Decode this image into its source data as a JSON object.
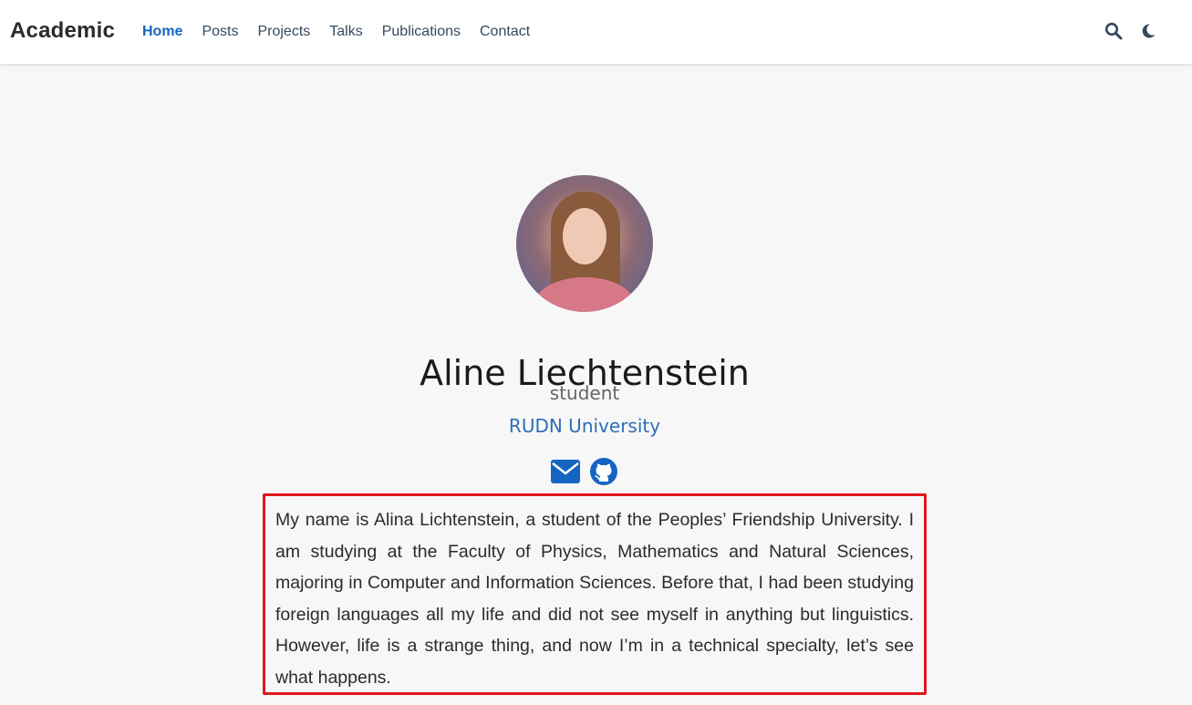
{
  "navbar": {
    "brand": "Academic",
    "links": [
      {
        "label": "Home",
        "active": true
      },
      {
        "label": "Posts",
        "active": false
      },
      {
        "label": "Projects",
        "active": false
      },
      {
        "label": "Talks",
        "active": false
      },
      {
        "label": "Publications",
        "active": false
      },
      {
        "label": "Contact",
        "active": false
      }
    ],
    "icons": [
      "search-icon",
      "moon-icon"
    ]
  },
  "profile": {
    "name": "Aline Liechtenstein",
    "role": "student",
    "organization": "RUDN University",
    "socials": [
      "envelope-icon",
      "github-icon"
    ],
    "bio": "My name is Alina Lichtenstein, a student of the Peoples’ Friendship University. I am studying at the Faculty of Physics, Mathematics and Natural Sciences, majoring in Computer and Information Sciences. Before that, I had been studying foreign languages all my life and did not see myself in anything but linguistics. However, life is a strange thing, and now I’m in a technical specialty, let’s see what happens."
  },
  "colors": {
    "accent": "#1565c0",
    "link": "#2c6eb6",
    "highlight_border": "#e0161e",
    "background": "#f7f7f7"
  }
}
